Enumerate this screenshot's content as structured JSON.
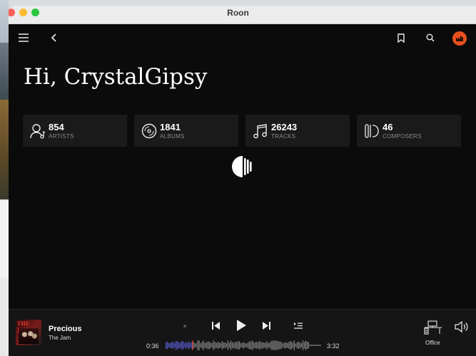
{
  "window": {
    "title": "Roon",
    "traffic_lights": {
      "close": "#fe5f57",
      "minimize": "#febc2e",
      "maximize": "#28c840"
    }
  },
  "topbar": {
    "menu_icon": "hamburger-icon",
    "back_icon": "chevron-left-icon",
    "bookmark_icon": "bookmark-icon",
    "search_icon": "search-icon",
    "profile_icon": "profile-avatar",
    "avatar_color": "#e8501f"
  },
  "home": {
    "greeting": "Hi, CrystalGipsy",
    "stats": [
      {
        "value": "854",
        "label": "ARTISTS",
        "icon": "artist-icon"
      },
      {
        "value": "1841",
        "label": "ALBUMS",
        "icon": "album-icon"
      },
      {
        "value": "26243",
        "label": "TRACKS",
        "icon": "music-note-icon"
      },
      {
        "value": "46",
        "label": "COMPOSERS",
        "icon": "composer-icon"
      }
    ],
    "loading_icon": "roon-loading-icon"
  },
  "player": {
    "track_title": "Precious",
    "track_artist": "The Jam",
    "album_art_text": "THE JAM",
    "elapsed": "0:36",
    "duration": "3:32",
    "progress": 0.17,
    "zone": "Office",
    "accent_played": "#5a5fd8",
    "playhead_color": "#e03a3a"
  }
}
